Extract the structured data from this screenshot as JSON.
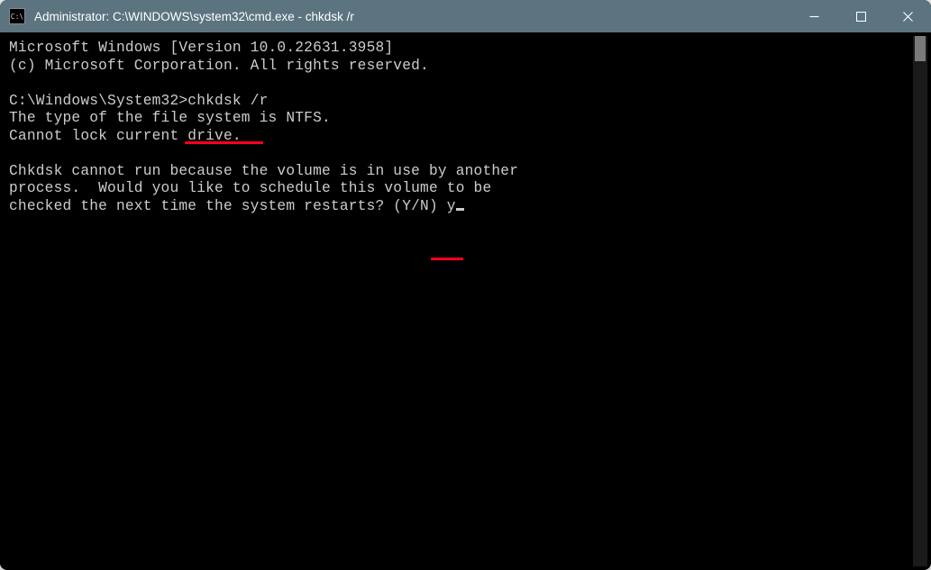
{
  "titlebar": {
    "icon_label": "C:\\",
    "title": "Administrator: C:\\WINDOWS\\system32\\cmd.exe - chkdsk  /r"
  },
  "terminal": {
    "line1": "Microsoft Windows [Version 10.0.22631.3958]",
    "line2": "(c) Microsoft Corporation. All rights reserved.",
    "blank1": "",
    "prompt_path": "C:\\Windows\\System32>",
    "command": "chkdsk /r",
    "out1": "The type of the file system is NTFS.",
    "out2": "Cannot lock current drive.",
    "blank2": "",
    "out3": "Chkdsk cannot run because the volume is in use by another",
    "out4": "process.  Would you like to schedule this volume to be",
    "out5": "checked the next time the system restarts? (Y/N) ",
    "user_answer": "y"
  }
}
